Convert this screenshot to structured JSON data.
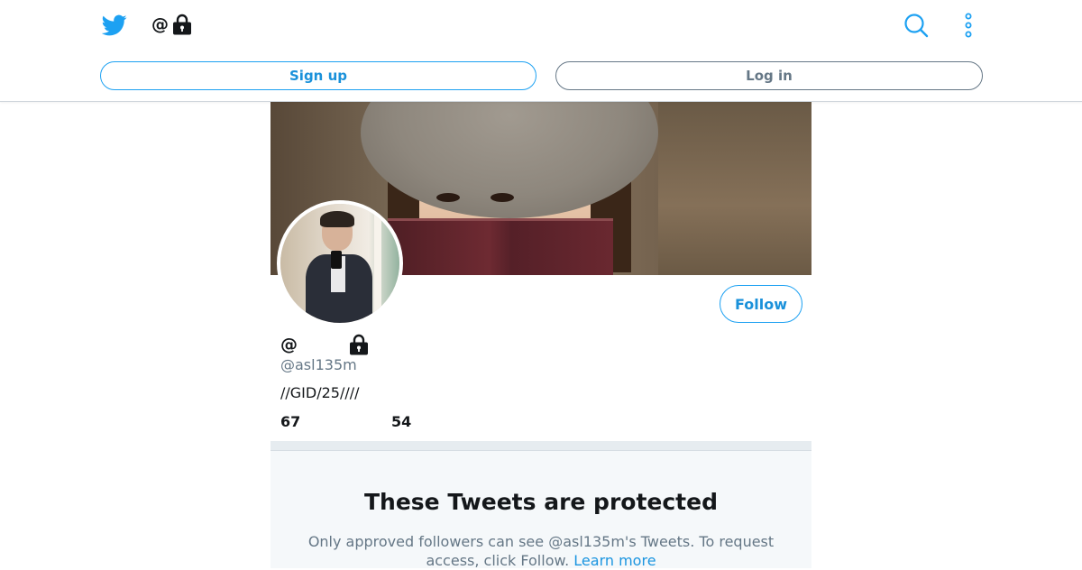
{
  "header": {
    "title_prefix": "@",
    "signup_label": "Sign up",
    "login_label": "Log in",
    "icons": [
      "twitter-bird-icon",
      "lock-icon",
      "search-icon",
      "more-vertical-icon"
    ]
  },
  "profile": {
    "name_prefix": "@",
    "handle": "@asl135m",
    "bio": "//GID/25////",
    "stat_1": "67",
    "stat_2": "54",
    "follow_label": "Follow"
  },
  "protected": {
    "title": "These Tweets are protected",
    "message": "Only approved followers can see @asl135m's Tweets. To request access, click Follow.",
    "learn_more": "Learn more"
  },
  "colors": {
    "brand_blue": "#1da1f2",
    "link_blue": "#1b95e0",
    "muted_gray": "#657786",
    "panel_bg": "#f5f8fa"
  }
}
